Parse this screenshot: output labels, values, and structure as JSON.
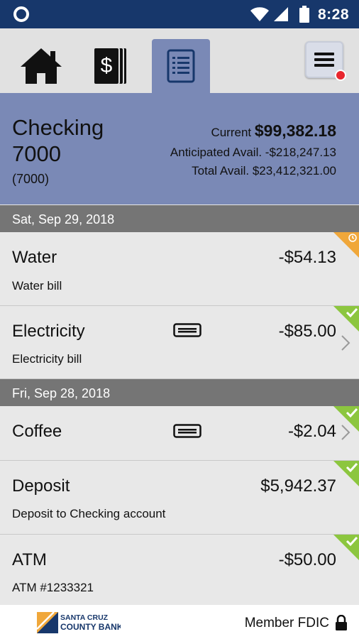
{
  "status_bar": {
    "time": "8:28"
  },
  "tabs": [
    {
      "icon": "home-icon"
    },
    {
      "icon": "money-icon"
    },
    {
      "icon": "statement-icon"
    }
  ],
  "account": {
    "name": "Checking 7000",
    "sub": "(7000)",
    "current_label": "Current",
    "current_amount": "$99,382.18",
    "anticipated": "Anticipated Avail. -$218,247.13",
    "total": "Total Avail. $23,412,321.00"
  },
  "groups": [
    {
      "date": "Sat, Sep 29, 2018",
      "transactions": [
        {
          "name": "Water",
          "memo": "Water bill",
          "amount": "-$54.13",
          "status": "pending"
        },
        {
          "name": "Electricity",
          "memo": "Electricity bill",
          "amount": "-$85.00",
          "status": "cleared"
        }
      ]
    },
    {
      "date": "Fri, Sep 28, 2018",
      "transactions": [
        {
          "name": "Coffee",
          "memo": "",
          "amount": "-$2.04",
          "status": "cleared"
        },
        {
          "name": "Deposit",
          "memo": "Deposit to Checking account",
          "amount": "$5,942.37",
          "status": "cleared"
        },
        {
          "name": "ATM",
          "memo": "ATM #1233321",
          "amount": "-$50.00",
          "status": "cleared"
        }
      ]
    }
  ],
  "footer": {
    "logo_text": "SANTA CRUZ COUNTY BANK",
    "member": "Member FDIC"
  },
  "colors": {
    "header_blue": "#17376b",
    "account_bg": "#7a89b6",
    "cleared": "#8cc63f",
    "pending": "#f0a73a",
    "badge": "#e8262e"
  }
}
